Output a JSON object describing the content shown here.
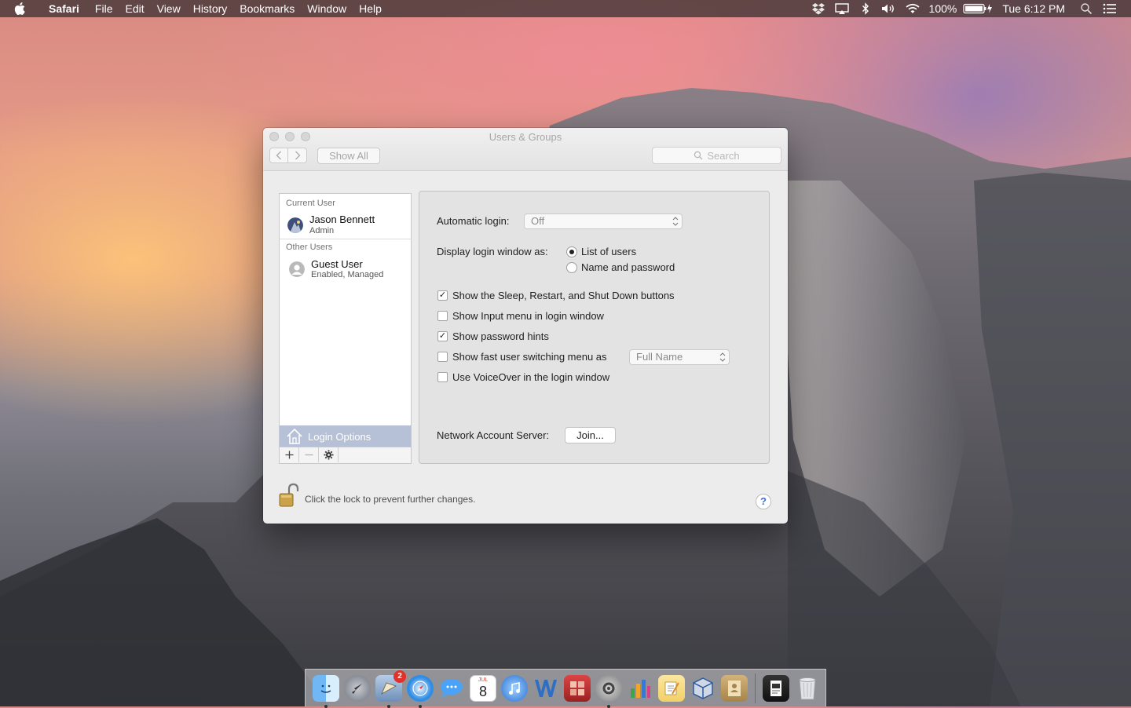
{
  "menubar": {
    "app_name": "Safari",
    "menus": [
      "File",
      "Edit",
      "View",
      "History",
      "Bookmarks",
      "Window",
      "Help"
    ],
    "battery": "100%",
    "clock": "Tue 6:12 PM"
  },
  "window": {
    "title": "Users & Groups",
    "show_all": "Show All",
    "search_placeholder": "Search"
  },
  "users": {
    "current_label": "Current User",
    "current": {
      "name": "Jason Bennett",
      "role": "Admin"
    },
    "other_label": "Other Users",
    "others": [
      {
        "name": "Guest User",
        "status": "Enabled, Managed"
      }
    ],
    "login_options_label": "Login Options"
  },
  "options": {
    "automatic_login_label": "Automatic login:",
    "automatic_login_value": "Off",
    "display_login_label": "Display login window as:",
    "display_choices": [
      {
        "label": "List of users",
        "selected": true
      },
      {
        "label": "Name and password",
        "selected": false
      }
    ],
    "checkboxes": [
      {
        "label": "Show the Sleep, Restart, and Shut Down buttons",
        "checked": true
      },
      {
        "label": "Show Input menu in login window",
        "checked": false
      },
      {
        "label": "Show password hints",
        "checked": true
      },
      {
        "label": "Show fast user switching menu as",
        "checked": false
      },
      {
        "label": "Use VoiceOver in the login window",
        "checked": false
      }
    ],
    "fast_switch_value": "Full Name",
    "network_server_label": "Network Account Server:",
    "join_button": "Join..."
  },
  "footer": {
    "lock_text": "Click the lock to prevent further changes.",
    "help": "?"
  },
  "dock": {
    "calendar_month": "JUL",
    "calendar_day": "8",
    "mail_badge": "2"
  }
}
